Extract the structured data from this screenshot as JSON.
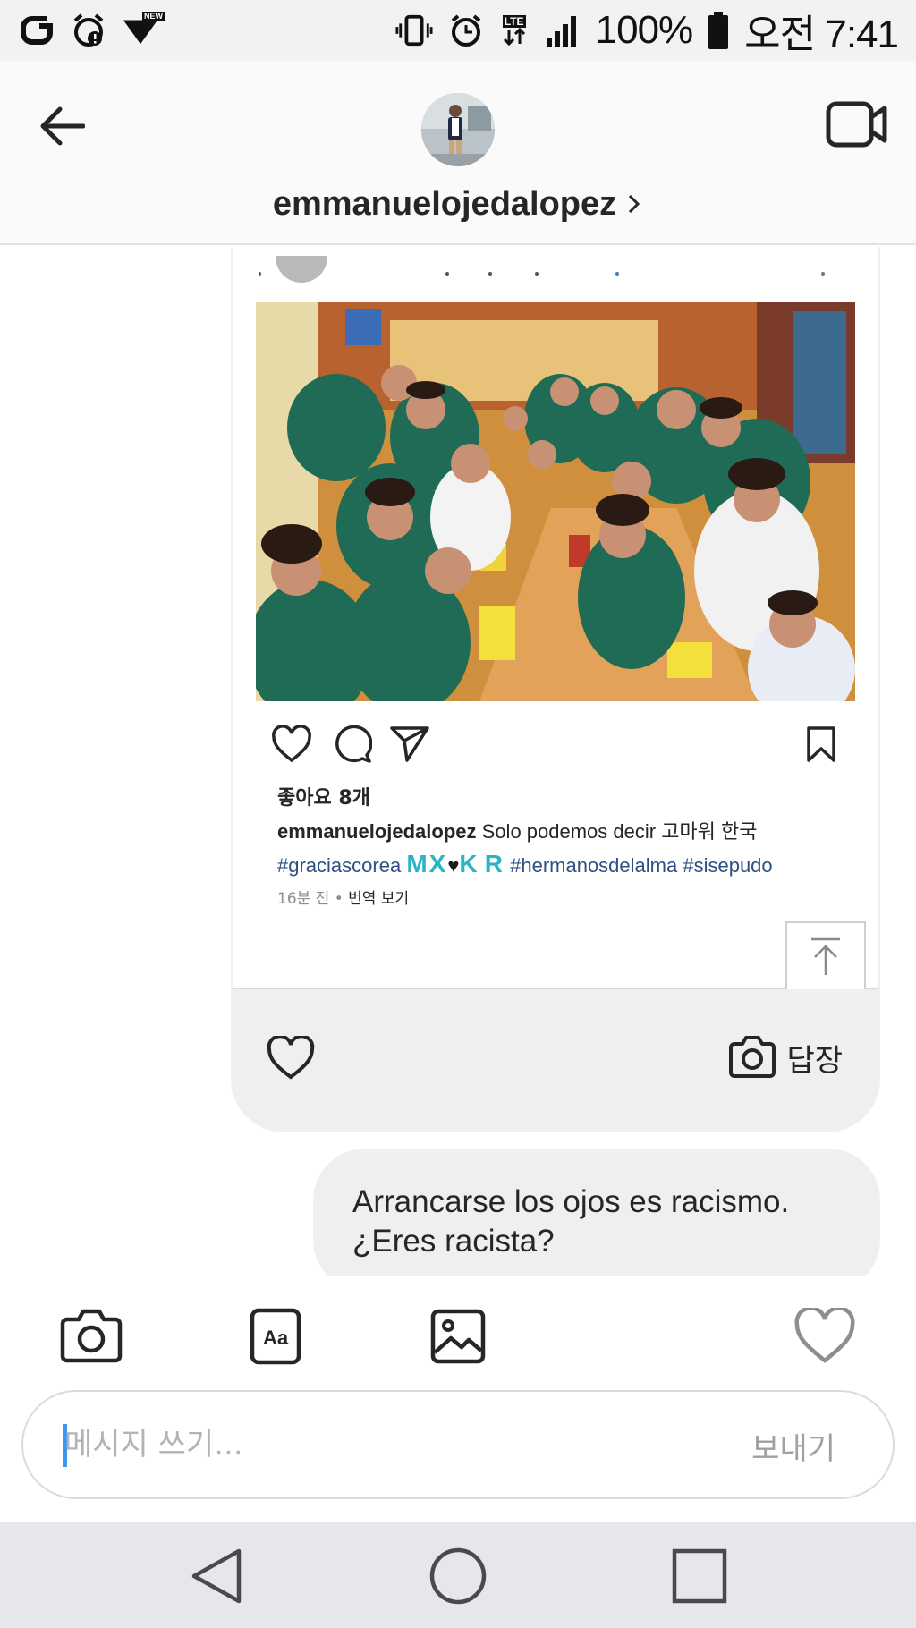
{
  "status_bar": {
    "battery": "100%",
    "time": "오전 7:41",
    "network": "LTE",
    "badge": "NEW"
  },
  "header": {
    "username": "emmanuelojedalopez"
  },
  "shared_post": {
    "likes": "좋아요 8개",
    "caption_user": "emmanuelojedalopez",
    "caption_text": "Solo podemos decir 고마워 한국",
    "tags": [
      "#graciascorea",
      "#hermanosdelalma",
      "#sisepudo"
    ],
    "emblem": {
      "m": "M",
      "x": "X",
      "k": "K",
      "r": "R",
      "heart": "♥"
    },
    "time_ago": "16분 전",
    "separator": "•",
    "translate": "번역 보기"
  },
  "card_footer": {
    "reply_label": "답장"
  },
  "message": {
    "line1": "Arrancarse los ojos es racismo.",
    "line2": "¿Eres racista?"
  },
  "composer": {
    "placeholder": "메시지 쓰기...",
    "send_label": "보내기"
  },
  "colors": {
    "hashtag": "#2f4f86",
    "emblem": "#2ab5c6",
    "bubble_bg": "#efefef",
    "caret": "#3897f0"
  },
  "icons": [
    "back-arrow-icon",
    "video-camera-icon",
    "heart-icon",
    "comment-icon",
    "send-icon",
    "bookmark-icon",
    "camera-icon",
    "text-format-icon",
    "gallery-icon",
    "nav-back-icon",
    "nav-home-icon",
    "nav-recents-icon"
  ]
}
